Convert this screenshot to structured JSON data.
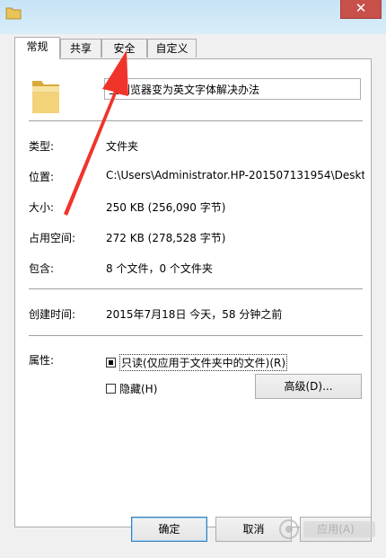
{
  "window": {
    "close_glyph": "✕"
  },
  "tabs": [
    "常规",
    "共享",
    "安全",
    "自定义"
  ],
  "name_field": {
    "value": "主浏览器变为英文字体解决办法"
  },
  "properties": [
    {
      "label": "类型:",
      "value": "文件夹"
    },
    {
      "label": "位置:",
      "value": "C:\\Users\\Administrator.HP-201507131954\\Deskto"
    },
    {
      "label": "大小:",
      "value": "250 KB (256,090 字节)"
    },
    {
      "label": "占用空间:",
      "value": "272 KB (278,528 字节)"
    },
    {
      "label": "包含:",
      "value": "8 个文件，0 个文件夹"
    }
  ],
  "created": {
    "label": "创建时间:",
    "value": "2015年7月18日 今天，58 分钟之前"
  },
  "attributes": {
    "label": "属性:",
    "readonly": {
      "text": "只读(仅应用于文件夹中的文件)(R)",
      "checked": true
    },
    "hidden": {
      "text": "隐藏(H)",
      "checked": false
    },
    "advanced_label": "高级(D)..."
  },
  "buttons": {
    "ok": "确定",
    "cancel": "取消",
    "apply": "应用(A)"
  },
  "colors": {
    "arrow": "#f0342c",
    "accent": "#3c7fb1",
    "folder": "#e8c35a"
  },
  "icons": {
    "title": "folder-icon",
    "large": "folder-icon",
    "watermark": "baidu-jingyan-logo"
  }
}
